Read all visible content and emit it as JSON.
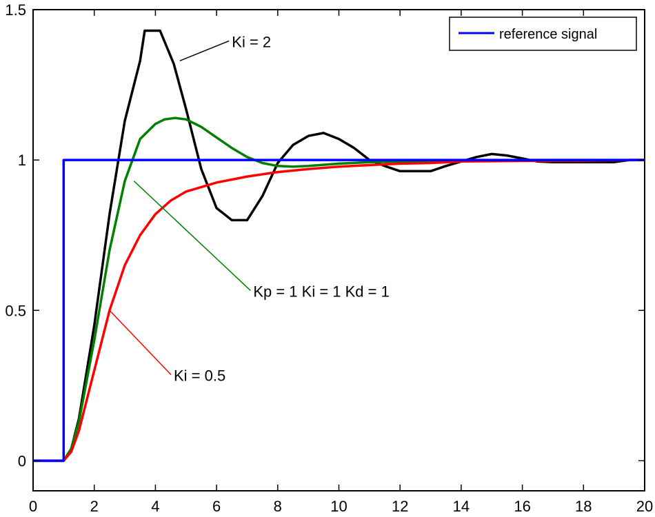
{
  "chart_data": {
    "type": "line",
    "title": "",
    "xlabel": "",
    "ylabel": "",
    "xlim": [
      0,
      20
    ],
    "ylim": [
      -0.1,
      1.5
    ],
    "grid": false,
    "xticks": [
      0,
      2,
      4,
      6,
      8,
      10,
      12,
      14,
      16,
      18,
      20
    ],
    "xtick_labels": [
      "0",
      "2",
      "4",
      "6",
      "8",
      "10",
      "12",
      "14",
      "16",
      "18",
      "20"
    ],
    "yticks": [
      0,
      0.5,
      1,
      1.5
    ],
    "ytick_labels": [
      "0",
      "0.5",
      "1",
      "1.5"
    ],
    "legend": {
      "placement": "top-right",
      "entries": [
        {
          "label": "reference signal",
          "color": "#0000ff"
        }
      ]
    },
    "series": [
      {
        "name": "reference signal",
        "color": "#0000ff",
        "x": [
          0,
          1,
          1,
          20
        ],
        "y": [
          0,
          0,
          1,
          1
        ]
      },
      {
        "name": "Ki = 2",
        "color": "#000000",
        "x": [
          0,
          1,
          1.25,
          1.5,
          2,
          2.5,
          3,
          3.5,
          3.65,
          4.15,
          4.6,
          5,
          5.5,
          6,
          6.5,
          7,
          7.5,
          8,
          8.5,
          9,
          9.5,
          10,
          10.5,
          11,
          11.5,
          12,
          12.5,
          13,
          13.5,
          14,
          14.5,
          15,
          15.5,
          16,
          16.5,
          17,
          17.5,
          18,
          18.5,
          19,
          19.5,
          20
        ],
        "y": [
          0,
          0,
          0.04,
          0.14,
          0.45,
          0.82,
          1.13,
          1.33,
          1.43,
          1.43,
          1.32,
          1.17,
          0.97,
          0.84,
          0.8,
          0.8,
          0.88,
          0.99,
          1.05,
          1.08,
          1.09,
          1.07,
          1.04,
          1.0,
          0.98,
          0.963,
          0.963,
          0.963,
          0.98,
          0.995,
          1.01,
          1.02,
          1.015,
          1.005,
          0.995,
          0.993,
          0.993,
          0.993,
          0.993,
          0.993,
          1.0,
          1.0
        ]
      },
      {
        "name": "Kp = 1  Ki = 1  Kd = 1",
        "color": "#008000",
        "x": [
          0,
          1,
          1.25,
          1.5,
          2,
          2.5,
          3,
          3.5,
          4,
          4.3,
          4.65,
          5,
          5.5,
          6,
          6.5,
          7,
          7.5,
          8,
          8.5,
          9,
          10,
          11,
          12,
          14,
          16,
          18,
          20
        ],
        "y": [
          0,
          0,
          0.04,
          0.13,
          0.4,
          0.7,
          0.93,
          1.07,
          1.12,
          1.135,
          1.14,
          1.135,
          1.11,
          1.075,
          1.04,
          1.01,
          0.99,
          0.98,
          0.978,
          0.98,
          0.988,
          0.993,
          0.995,
          0.998,
          1.0,
          1.0,
          1.0
        ]
      },
      {
        "name": "Ki = 0.5",
        "color": "#ff0000",
        "x": [
          0,
          1,
          1.25,
          1.5,
          2,
          2.5,
          3,
          3.5,
          4,
          4.5,
          5,
          5.5,
          6,
          7,
          8,
          9,
          10,
          11,
          12,
          13,
          14,
          16,
          18,
          20
        ],
        "y": [
          0,
          0,
          0.03,
          0.1,
          0.3,
          0.5,
          0.65,
          0.75,
          0.82,
          0.865,
          0.895,
          0.91,
          0.925,
          0.945,
          0.96,
          0.97,
          0.978,
          0.983,
          0.988,
          0.99,
          0.995,
          0.997,
          0.998,
          1.0
        ]
      }
    ],
    "annotations": [
      {
        "text": "Ki = 2",
        "color": "#000000",
        "point": [
          4.8,
          1.33
        ],
        "text_at": [
          6.5,
          1.38
        ]
      },
      {
        "text": "Kp = 1  Ki = 1  Kd = 1",
        "color": "#008000",
        "point": [
          3.3,
          0.93
        ],
        "text_at": [
          7.2,
          0.55
        ]
      },
      {
        "text": "Ki = 0.5",
        "color": "#ff0000",
        "point": [
          2.5,
          0.5
        ],
        "text_at": [
          4.6,
          0.27
        ]
      }
    ]
  }
}
